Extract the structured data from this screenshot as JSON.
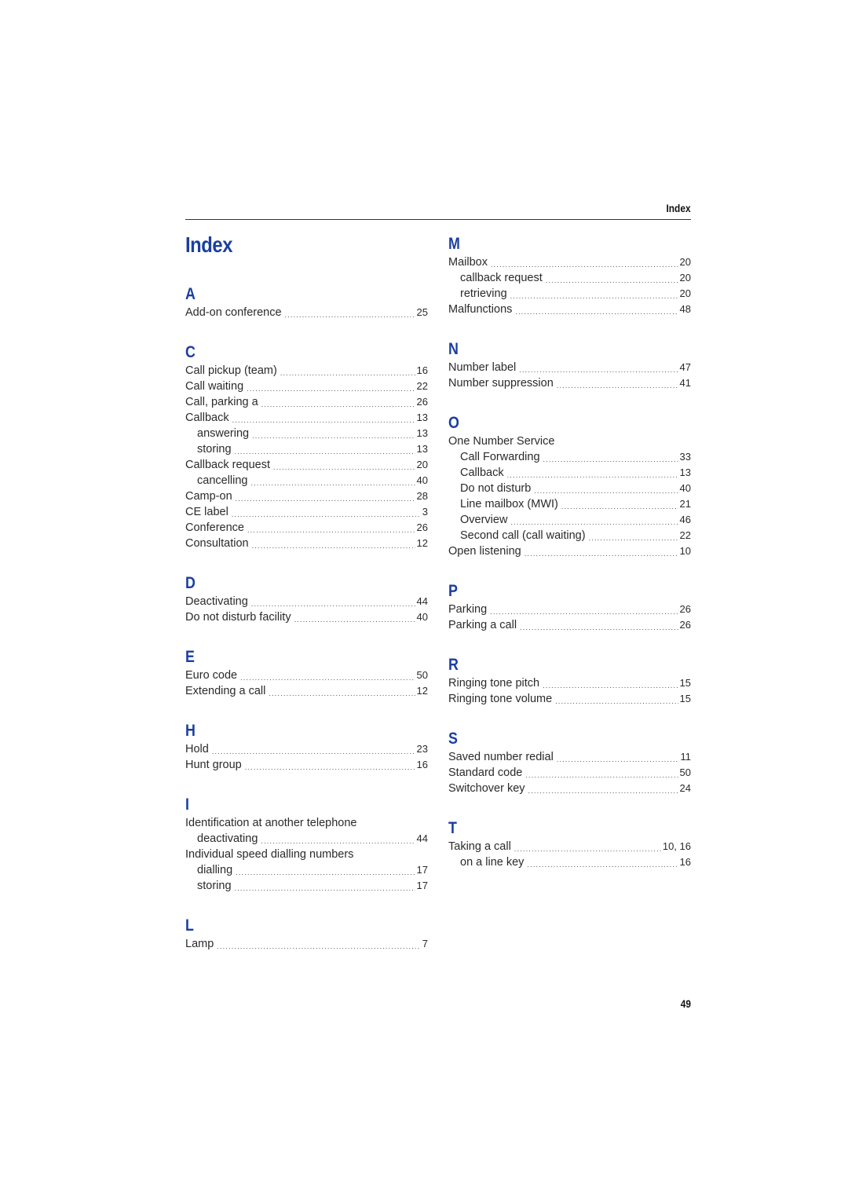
{
  "colors": {
    "accent": "#1a3fa0"
  },
  "running_head": "Index",
  "page_title": "Index",
  "page_number": "49",
  "left_column": [
    {
      "letter": "A",
      "entries": [
        {
          "term": "Add-on conference",
          "page": "25",
          "level": 0
        }
      ]
    },
    {
      "letter": "C",
      "entries": [
        {
          "term": "Call pickup (team)",
          "page": "16",
          "level": 0
        },
        {
          "term": "Call waiting",
          "page": "22",
          "level": 0
        },
        {
          "term": "Call, parking a",
          "page": "26",
          "level": 0
        },
        {
          "term": "Callback",
          "page": "13",
          "level": 0
        },
        {
          "term": "answering",
          "page": "13",
          "level": 1
        },
        {
          "term": "storing",
          "page": "13",
          "level": 1
        },
        {
          "term": "Callback request",
          "page": "20",
          "level": 0
        },
        {
          "term": "cancelling",
          "page": "40",
          "level": 1
        },
        {
          "term": "Camp-on",
          "page": "28",
          "level": 0
        },
        {
          "term": "CE label",
          "page": "3",
          "level": 0
        },
        {
          "term": "Conference",
          "page": "26",
          "level": 0
        },
        {
          "term": "Consultation",
          "page": "12",
          "level": 0
        }
      ]
    },
    {
      "letter": "D",
      "entries": [
        {
          "term": "Deactivating",
          "page": "44",
          "level": 0
        },
        {
          "term": "Do not disturb facility",
          "page": "40",
          "level": 0
        }
      ]
    },
    {
      "letter": "E",
      "entries": [
        {
          "term": "Euro code",
          "page": "50",
          "level": 0
        },
        {
          "term": "Extending a call",
          "page": "12",
          "level": 0
        }
      ]
    },
    {
      "letter": "H",
      "entries": [
        {
          "term": "Hold",
          "page": "23",
          "level": 0
        },
        {
          "term": "Hunt group",
          "page": "16",
          "level": 0
        }
      ]
    },
    {
      "letter": "I",
      "entries": [
        {
          "term": "Identification at another telephone",
          "page": "",
          "level": 0
        },
        {
          "term": "deactivating",
          "page": "44",
          "level": 1
        },
        {
          "term": "Individual speed dialling numbers",
          "page": "",
          "level": 0
        },
        {
          "term": "dialling",
          "page": "17",
          "level": 1
        },
        {
          "term": "storing",
          "page": "17",
          "level": 1
        }
      ]
    },
    {
      "letter": "L",
      "entries": [
        {
          "term": "Lamp",
          "page": "7",
          "level": 0
        }
      ]
    }
  ],
  "right_column": [
    {
      "letter": "M",
      "entries": [
        {
          "term": "Mailbox",
          "page": "20",
          "level": 0
        },
        {
          "term": "callback request",
          "page": "20",
          "level": 1
        },
        {
          "term": "retrieving",
          "page": "20",
          "level": 1
        },
        {
          "term": "Malfunctions",
          "page": "48",
          "level": 0
        }
      ]
    },
    {
      "letter": "N",
      "entries": [
        {
          "term": "Number label",
          "page": "47",
          "level": 0
        },
        {
          "term": "Number suppression",
          "page": "41",
          "level": 0
        }
      ]
    },
    {
      "letter": "O",
      "entries": [
        {
          "term": "One Number Service",
          "page": "",
          "level": 0
        },
        {
          "term": "Call Forwarding",
          "page": "33",
          "level": 1
        },
        {
          "term": "Callback",
          "page": "13",
          "level": 1
        },
        {
          "term": "Do not disturb",
          "page": "40",
          "level": 1
        },
        {
          "term": "Line mailbox (MWI)",
          "page": "21",
          "level": 1
        },
        {
          "term": "Overview",
          "page": "46",
          "level": 1
        },
        {
          "term": "Second call (call waiting)",
          "page": "22",
          "level": 1
        },
        {
          "term": "Open listening",
          "page": "10",
          "level": 0
        }
      ]
    },
    {
      "letter": "P",
      "entries": [
        {
          "term": "Parking",
          "page": "26",
          "level": 0
        },
        {
          "term": "Parking a call",
          "page": "26",
          "level": 0
        }
      ]
    },
    {
      "letter": "R",
      "entries": [
        {
          "term": "Ringing tone pitch",
          "page": "15",
          "level": 0
        },
        {
          "term": "Ringing tone volume",
          "page": "15",
          "level": 0
        }
      ]
    },
    {
      "letter": "S",
      "entries": [
        {
          "term": "Saved number redial",
          "page": "11",
          "level": 0
        },
        {
          "term": "Standard code",
          "page": "50",
          "level": 0
        },
        {
          "term": "Switchover key",
          "page": "24",
          "level": 0
        }
      ]
    },
    {
      "letter": "T",
      "entries": [
        {
          "term": "Taking a call",
          "page": "10, 16",
          "level": 0
        },
        {
          "term": "on a line key",
          "page": "16",
          "level": 1
        }
      ]
    }
  ]
}
